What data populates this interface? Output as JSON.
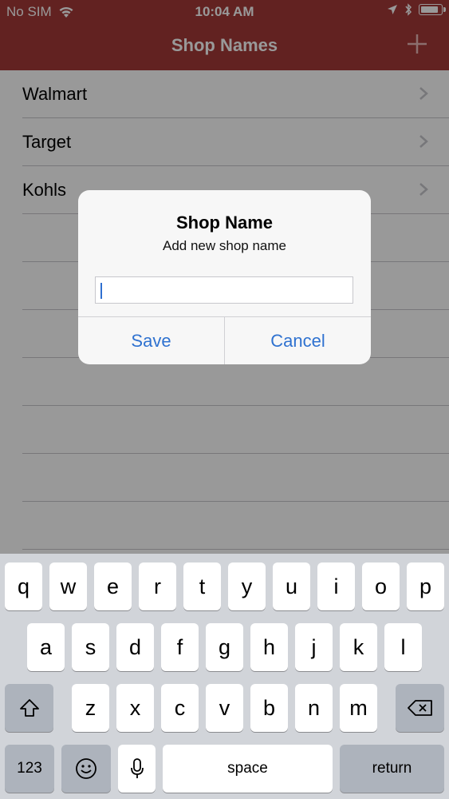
{
  "status_bar": {
    "carrier": "No SIM",
    "time": "10:04 AM",
    "battery_level": 0.9
  },
  "nav": {
    "title": "Shop Names",
    "add_icon": "plus-icon"
  },
  "list": {
    "items": [
      {
        "label": "Walmart"
      },
      {
        "label": "Target"
      },
      {
        "label": "Kohls"
      }
    ]
  },
  "alert": {
    "title": "Shop Name",
    "message": "Add new shop name",
    "input": {
      "value": "",
      "placeholder": ""
    },
    "save_label": "Save",
    "cancel_label": "Cancel"
  },
  "keyboard": {
    "row1": [
      "q",
      "w",
      "e",
      "r",
      "t",
      "y",
      "u",
      "i",
      "o",
      "p"
    ],
    "row2": [
      "a",
      "s",
      "d",
      "f",
      "g",
      "h",
      "j",
      "k",
      "l"
    ],
    "row3": [
      "z",
      "x",
      "c",
      "v",
      "b",
      "n",
      "m"
    ],
    "numbers_label": "123",
    "space_label": "space",
    "return_label": "return",
    "icons": {
      "shift": "shift-icon",
      "delete": "delete-icon",
      "emoji": "emoji-icon",
      "mic": "microphone-icon"
    }
  },
  "colors": {
    "nav_bg": "#a33a37",
    "accent": "#2f72d0"
  }
}
